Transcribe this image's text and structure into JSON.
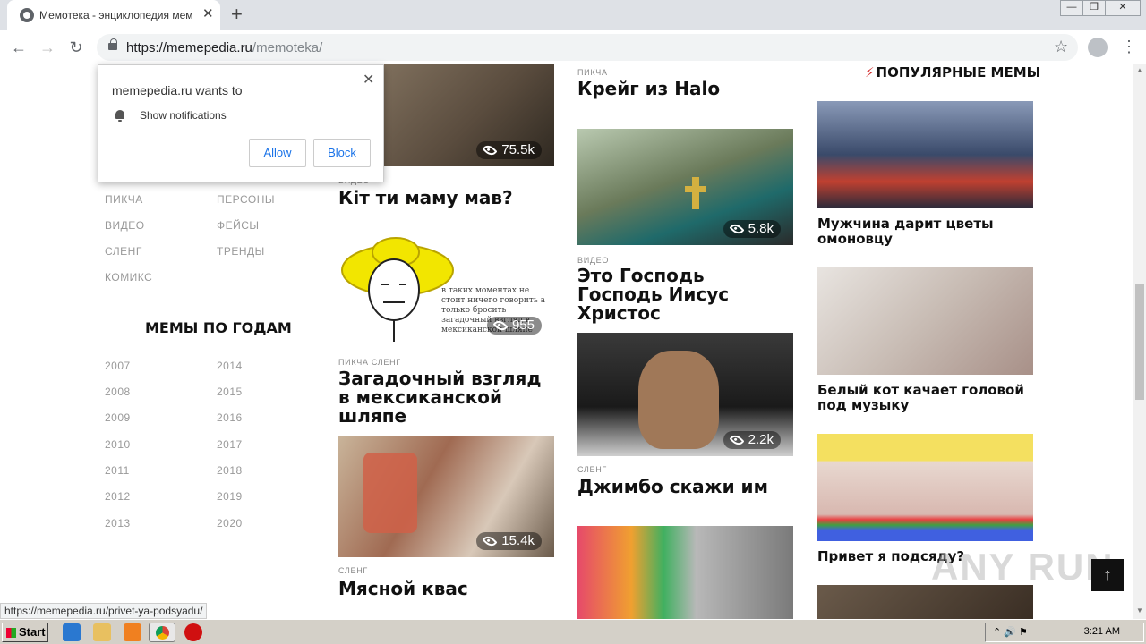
{
  "browser": {
    "tab_title": "Мемотека - энциклопедия мемов",
    "tab_close": "✕",
    "new_tab": "+",
    "url_domain": "https://memepedia.ru",
    "url_path": "/memoteka/",
    "status_url": "https://memepedia.ru/privet-ya-podsyadu/"
  },
  "notification": {
    "heading": "memepedia.ru wants to",
    "message": "Show notifications",
    "allow": "Allow",
    "block": "Block"
  },
  "sidebar": {
    "categories": [
      "ПИКЧА",
      "ПЕРСОНЫ",
      "ВИДЕО",
      "ФЕЙСЫ",
      "СЛЕНГ",
      "ТРЕНДЫ",
      "КОМИКС"
    ],
    "years_heading": "МЕМЫ ПО ГОДАМ",
    "years": [
      "2007",
      "2014",
      "2008",
      "2015",
      "2009",
      "2016",
      "2010",
      "2017",
      "2011",
      "2018",
      "2012",
      "2019",
      "2013",
      "2020"
    ]
  },
  "col1": [
    {
      "tag": "ВИДЕО",
      "title": "Кіт ти маму мав?",
      "views": "75.5k"
    },
    {
      "tag": "ПИКЧА  СЛЕНГ",
      "title": "Загадочный взгляд в мексиканской шляпе",
      "views": "955",
      "caption": "в таких моментах не стоит ничего говорить а только бросить загадочный взгляд в мексиканской шляпе"
    },
    {
      "tag": "СЛЕНГ",
      "title": "Мясной квас",
      "views": "15.4k"
    }
  ],
  "col2": [
    {
      "tag": "ПИКЧА",
      "title": "Крейг из Halo",
      "views": "5.8k"
    },
    {
      "tag": "ВИДЕО",
      "title": "Это Господь Господь Иисус Христос",
      "views": "2.2k"
    },
    {
      "tag": "СЛЕНГ",
      "title": "Джимбо скажи им"
    }
  ],
  "popular": {
    "heading": "ПОПУЛЯРНЫЕ МЕМЫ",
    "items": [
      {
        "title": "Мужчина дарит цветы омоновцу"
      },
      {
        "title": "Белый кот качает головой под музыку"
      },
      {
        "title": "Привет я подсяду?"
      }
    ]
  },
  "watermark": "ANY RUN",
  "taskbar": {
    "start": "Start",
    "clock": "3:21 AM"
  }
}
